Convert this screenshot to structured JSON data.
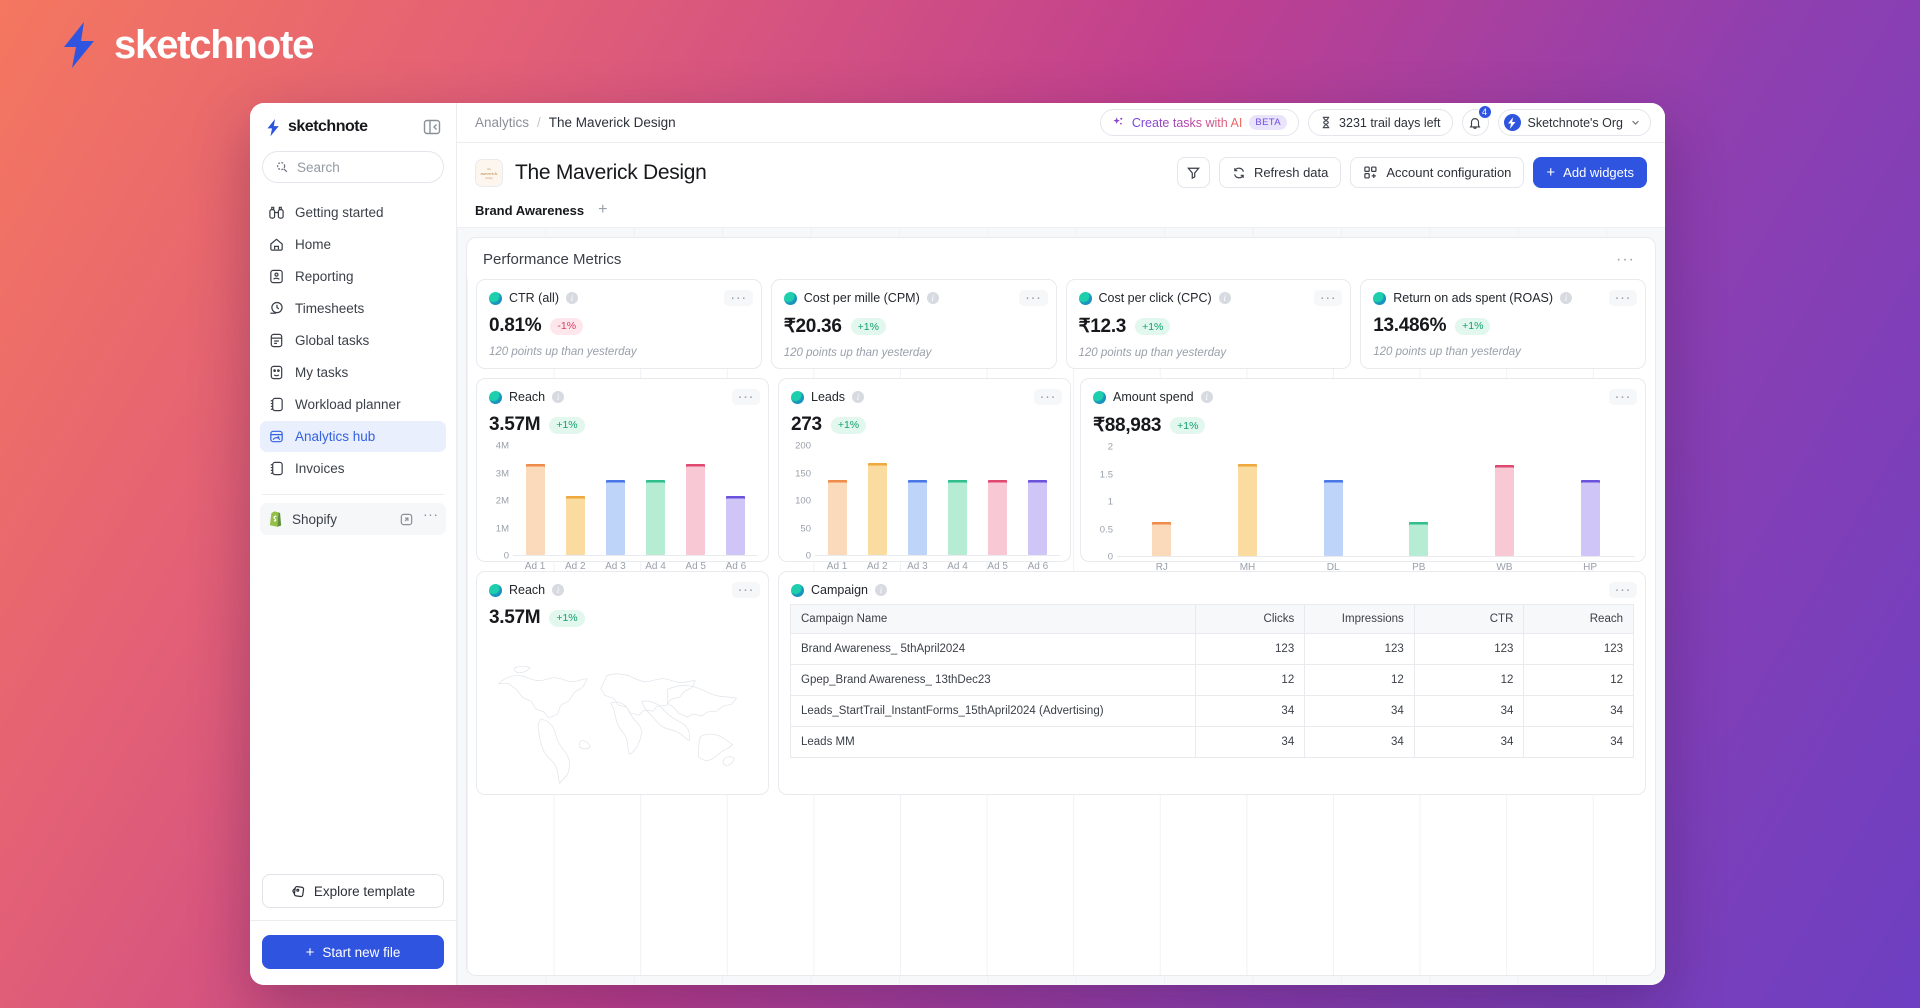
{
  "brand": {
    "name": "sketchnote"
  },
  "sidebar": {
    "logo_text": "sketchnote",
    "search_placeholder": "Search",
    "items": [
      {
        "label": "Getting started",
        "icon": "binoculars-icon"
      },
      {
        "label": "Home",
        "icon": "home-icon"
      },
      {
        "label": "Reporting",
        "icon": "report-icon"
      },
      {
        "label": "Timesheets",
        "icon": "timesheet-icon"
      },
      {
        "label": "Global tasks",
        "icon": "tasks-icon"
      },
      {
        "label": "My tasks",
        "icon": "my-tasks-icon"
      },
      {
        "label": "Workload planner",
        "icon": "planner-icon"
      },
      {
        "label": "Analytics hub",
        "icon": "analytics-icon",
        "active": true
      },
      {
        "label": "Invoices",
        "icon": "invoice-icon"
      }
    ],
    "app": {
      "label": "Shopify"
    },
    "explore_label": "Explore template",
    "start_label": "Start new file"
  },
  "topbar": {
    "breadcrumb": [
      "Analytics",
      "The Maverick Design"
    ],
    "breadcrumb_sep": "/",
    "ai_label": "Create tasks with AI",
    "beta_label": "BETA",
    "trial_label": "3231 trail days left",
    "notifications_count": "4",
    "org_label": "Sketchnote's Org"
  },
  "page": {
    "title": "The Maverick Design",
    "filter_label": "",
    "refresh_label": "Refresh data",
    "account_config_label": "Account configuration",
    "add_widgets_label": "Add widgets",
    "tab_label": "Brand Awareness",
    "tab_add": "+"
  },
  "panel": {
    "title": "Performance Metrics",
    "menu": "···"
  },
  "kpis": [
    {
      "name": "CTR (all)",
      "value": "0.81%",
      "delta": "-1%",
      "direction": "down",
      "sub": "120 points up than yesterday"
    },
    {
      "name": "Cost per mille (CPM)",
      "value": "₹20.36",
      "delta": "+1%",
      "direction": "up",
      "sub": "120 points up than yesterday"
    },
    {
      "name": "Cost per click (CPC)",
      "value": "₹12.3",
      "delta": "+1%",
      "direction": "up",
      "sub": "120 points up than yesterday"
    },
    {
      "name": "Return on ads spent (ROAS)",
      "value": "13.486%",
      "delta": "+1%",
      "direction": "up",
      "sub": "120 points up than yesterday"
    }
  ],
  "widgets": {
    "reach_bar": {
      "name": "Reach",
      "value": "3.57M",
      "delta": "+1%"
    },
    "leads": {
      "name": "Leads",
      "value": "273",
      "delta": "+1%"
    },
    "amount_spend": {
      "name": "Amount spend",
      "value": "₹88,983",
      "delta": "+1%"
    },
    "reach_map": {
      "name": "Reach",
      "value": "3.57M",
      "delta": "+1%"
    },
    "campaign": {
      "name": "Campaign"
    }
  },
  "chart_data": [
    {
      "type": "bar",
      "title": "Reach",
      "categories": [
        "Ad 1",
        "Ad 2",
        "Ad 3",
        "Ad 4",
        "Ad 5",
        "Ad 6"
      ],
      "values": [
        3350000,
        2150000,
        2750000,
        2750000,
        3350000,
        2150000
      ],
      "ytick_labels": [
        "4M",
        "3M",
        "2M",
        "1M",
        "0"
      ],
      "ytick_values": [
        4000000,
        3000000,
        2000000,
        1000000,
        0
      ],
      "ylim": [
        0,
        4000000
      ],
      "xlabel": "",
      "ylabel": "",
      "grid": false,
      "legend": "none",
      "colors": [
        "#fbd9bb",
        "#fadba0",
        "#bed4f8",
        "#b6ebd4",
        "#f8c8d4",
        "#cfc6f7"
      ],
      "cap_colors": [
        "#ef8b4b",
        "#efa93c",
        "#4a77e8",
        "#2fbf8d",
        "#e0496f",
        "#6a52dd"
      ]
    },
    {
      "type": "bar",
      "title": "Leads",
      "categories": [
        "Ad 1",
        "Ad 2",
        "Ad 3",
        "Ad 4",
        "Ad 5",
        "Ad 6"
      ],
      "values": [
        138,
        168,
        138,
        138,
        138,
        138
      ],
      "ytick_labels": [
        "200",
        "150",
        "100",
        "50",
        "0"
      ],
      "ytick_values": [
        200,
        150,
        100,
        50,
        0
      ],
      "ylim": [
        0,
        200
      ],
      "xlabel": "",
      "ylabel": "",
      "grid": false,
      "legend": "none",
      "colors": [
        "#fbd9bb",
        "#fadba0",
        "#bed4f8",
        "#b6ebd4",
        "#f8c8d4",
        "#cfc6f7"
      ],
      "cap_colors": [
        "#ef8b4b",
        "#efa93c",
        "#4a77e8",
        "#2fbf8d",
        "#e0496f",
        "#6a52dd"
      ]
    },
    {
      "type": "bar",
      "title": "Amount spend",
      "categories": [
        "RJ",
        "MH",
        "DL",
        "PB",
        "WB",
        "HP"
      ],
      "values": [
        0.62,
        1.68,
        1.4,
        0.62,
        1.67,
        1.4
      ],
      "ytick_labels": [
        "2",
        "1.5",
        "1",
        "0.5",
        "0"
      ],
      "ytick_values": [
        2,
        1.5,
        1,
        0.5,
        0
      ],
      "ylim": [
        0,
        2
      ],
      "xlabel": "",
      "ylabel": "",
      "grid": false,
      "legend": "none",
      "colors": [
        "#fbd9bb",
        "#fadba0",
        "#bed4f8",
        "#b6ebd4",
        "#f8c8d4",
        "#cfc6f7"
      ],
      "cap_colors": [
        "#ef8b4b",
        "#efa93c",
        "#4a77e8",
        "#2fbf8d",
        "#e0496f",
        "#6a52dd"
      ]
    },
    {
      "type": "table",
      "title": "Campaign",
      "columns": [
        "Campaign Name",
        "Clicks",
        "Impressions",
        "CTR",
        "Reach"
      ],
      "rows": [
        [
          "Brand Awareness_ 5thApril2024",
          "123",
          "123",
          "123",
          "123"
        ],
        [
          "Gpep_Brand Awareness_ 13thDec23",
          "12",
          "12",
          "12",
          "12"
        ],
        [
          "Leads_StartTrail_InstantForms_15thApril2024 (Advertising)",
          "34",
          "34",
          "34",
          "34"
        ],
        [
          "Leads MM",
          "34",
          "34",
          "34",
          "34"
        ]
      ]
    }
  ],
  "colors": {
    "accent": "#2f55e0",
    "up": "#12a06e",
    "down": "#d94064",
    "active_nav_bg": "#e9effd",
    "active_nav_text": "#3461e0"
  }
}
